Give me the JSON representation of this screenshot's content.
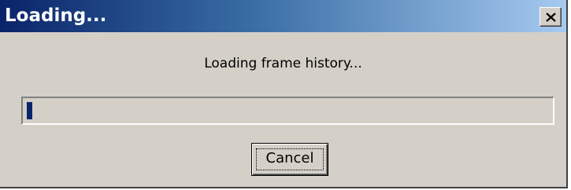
{
  "window": {
    "title": "Loading...",
    "close_icon": "close-x-icon"
  },
  "dialog": {
    "message": "Loading frame history...",
    "progress_fraction": 0.01,
    "cancel_label": "Cancel"
  },
  "colors": {
    "titlebar_start": "#0a246a",
    "titlebar_end": "#a6caf0",
    "face": "#d4d0c8",
    "progress_fill": "#0a246a"
  }
}
